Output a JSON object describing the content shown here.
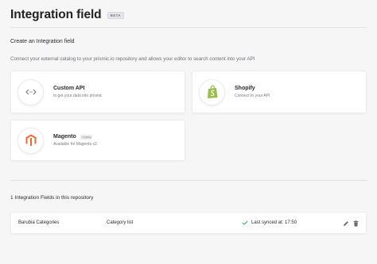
{
  "header": {
    "title": "Integration field",
    "beta_badge": "BETA"
  },
  "create_section": {
    "title": "Create an Integration field",
    "description": "Connect your external catalog to your prismic.io repository and allows your editor to search content into your API",
    "cards": [
      {
        "name": "Custom API",
        "subtitle": "to get your data into prismic",
        "icon": "code-brackets-icon",
        "badge": ""
      },
      {
        "name": "Shopify",
        "subtitle": "Connect to your API",
        "icon": "shopify-logo-icon",
        "badge": ""
      },
      {
        "name": "Magento",
        "subtitle": "Available for Magento v2",
        "icon": "magento-logo-icon",
        "badge": "Legacy"
      }
    ]
  },
  "fields_section": {
    "title": "1 Integration Fields in this repository",
    "rows": [
      {
        "name": "Barubia Categories",
        "type": "Category list",
        "sync_status": "Last synced at: 17:50"
      }
    ]
  },
  "colors": {
    "shopify_green": "#95bf47",
    "magento_orange": "#ee672f",
    "sync_check": "#3cb371"
  }
}
